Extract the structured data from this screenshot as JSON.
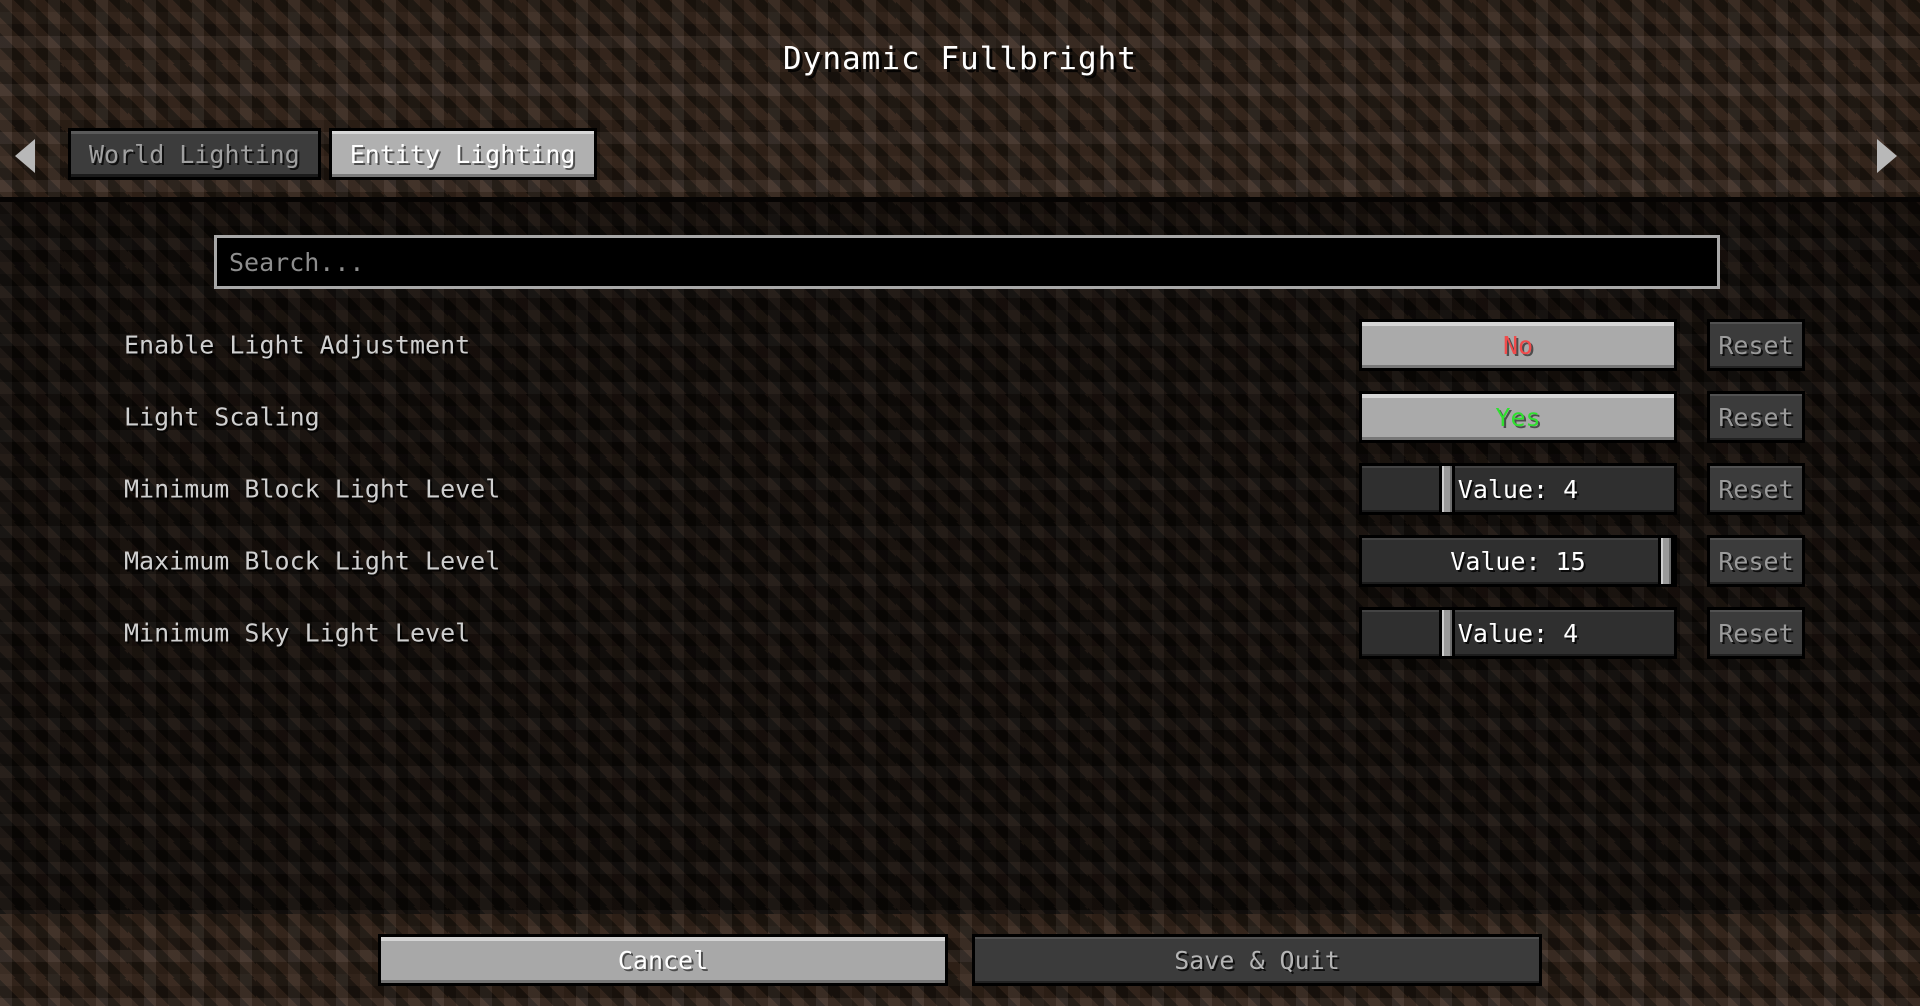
{
  "window": {
    "title": "Dynamic Fullbright"
  },
  "tabs": {
    "scroll_left_icon": "chevron-left-icon",
    "scroll_right_icon": "chevron-right-icon",
    "items": [
      {
        "label": "World Lighting",
        "active": false
      },
      {
        "label": "Entity Lighting",
        "active": true
      }
    ]
  },
  "search": {
    "value": "",
    "placeholder": "Search..."
  },
  "options": [
    {
      "label": "Enable Light Adjustment",
      "type": "boolean",
      "value": "No",
      "state": "no",
      "reset_label": "Reset"
    },
    {
      "label": "Light Scaling",
      "type": "boolean",
      "value": "Yes",
      "state": "yes",
      "reset_label": "Reset"
    },
    {
      "label": "Minimum Block Light Level",
      "type": "slider",
      "value": "Value: 4",
      "number": 4,
      "min": 0,
      "max": 15,
      "percent": 26,
      "reset_label": "Reset"
    },
    {
      "label": "Maximum Block Light Level",
      "type": "slider",
      "value": "Value: 15",
      "number": 15,
      "min": 0,
      "max": 15,
      "percent": 100,
      "reset_label": "Reset"
    },
    {
      "label": "Minimum Sky Light Level",
      "type": "slider",
      "value": "Value: 4",
      "number": 4,
      "min": 0,
      "max": 15,
      "percent": 26,
      "reset_label": "Reset"
    }
  ],
  "footer": {
    "cancel_label": "Cancel",
    "save_label": "Save & Quit"
  },
  "colors": {
    "accent_yes": "#2fe02f",
    "accent_no": "#f04b4b",
    "text_primary": "#ffffff",
    "text_muted": "#9b9b9b",
    "dirt": "#2a1e16",
    "dirt_dark": "#100b07"
  }
}
